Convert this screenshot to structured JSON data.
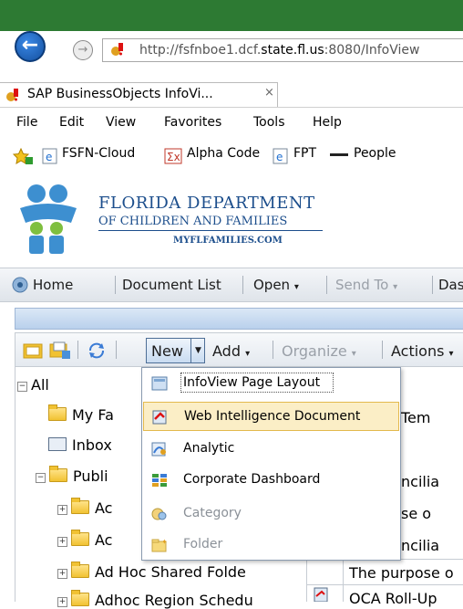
{
  "browser": {
    "address_prefix": "http://fsfnboe1.dcf.",
    "address_host": "state.fl.us",
    "address_suffix": ":8080/InfoView",
    "tab_title": "SAP BusinessObjects InfoVi...",
    "tab_close": "×",
    "back_glyph": "←",
    "forward_glyph": "→"
  },
  "menubar": {
    "items": [
      "File",
      "Edit",
      "View",
      "Favorites",
      "Tools",
      "Help"
    ]
  },
  "favorites": {
    "items": [
      "FSFN-Cloud",
      "Alpha Code",
      "FPT",
      "People"
    ]
  },
  "logo": {
    "line1": "FLORIDA DEPARTMENT",
    "line2": "OF CHILDREN AND FAMILIES",
    "line3": "MYFLFAMILIES.COM"
  },
  "app_toolbar": {
    "home": "Home",
    "document_list": "Document List",
    "open": "Open",
    "send_to": "Send To",
    "dash": "Das"
  },
  "toolbar2": {
    "new": "New",
    "add": "Add",
    "organize": "Organize",
    "actions": "Actions"
  },
  "tree": {
    "all": "All",
    "my_favorites": "My Fa",
    "inbox": "Inbox",
    "public": "Publi",
    "sub1": "Ac",
    "sub2": "Ac",
    "ad_hoc_shared": "Ad Hoc Shared Folde",
    "adhoc_region": "Adhoc Region Schedu"
  },
  "doc_list": {
    "frag1": "Tem",
    "frag2": "ncilia",
    "frag3": "se o",
    "frag4": "ncilia",
    "frag5": "The purpose o",
    "frag6": "OCA Roll-Up"
  },
  "new_menu": {
    "items": [
      {
        "label": "InfoView Page Layout",
        "icon": "page-layout-icon",
        "enabled": true
      },
      {
        "label": "Web Intelligence Document",
        "icon": "webi-document-icon",
        "enabled": true,
        "highlighted": true
      },
      {
        "label": "Analytic",
        "icon": "analytic-icon",
        "enabled": true
      },
      {
        "label": "Corporate Dashboard",
        "icon": "dashboard-icon",
        "enabled": true
      },
      {
        "label": "Category",
        "icon": "category-icon",
        "enabled": false
      },
      {
        "label": "Folder",
        "icon": "folder-icon",
        "enabled": false
      }
    ]
  },
  "colors": {
    "chrome_green": "#2d7a33",
    "brand_blue": "#1c4e8c",
    "menu_highlight": "#fbeec6"
  }
}
